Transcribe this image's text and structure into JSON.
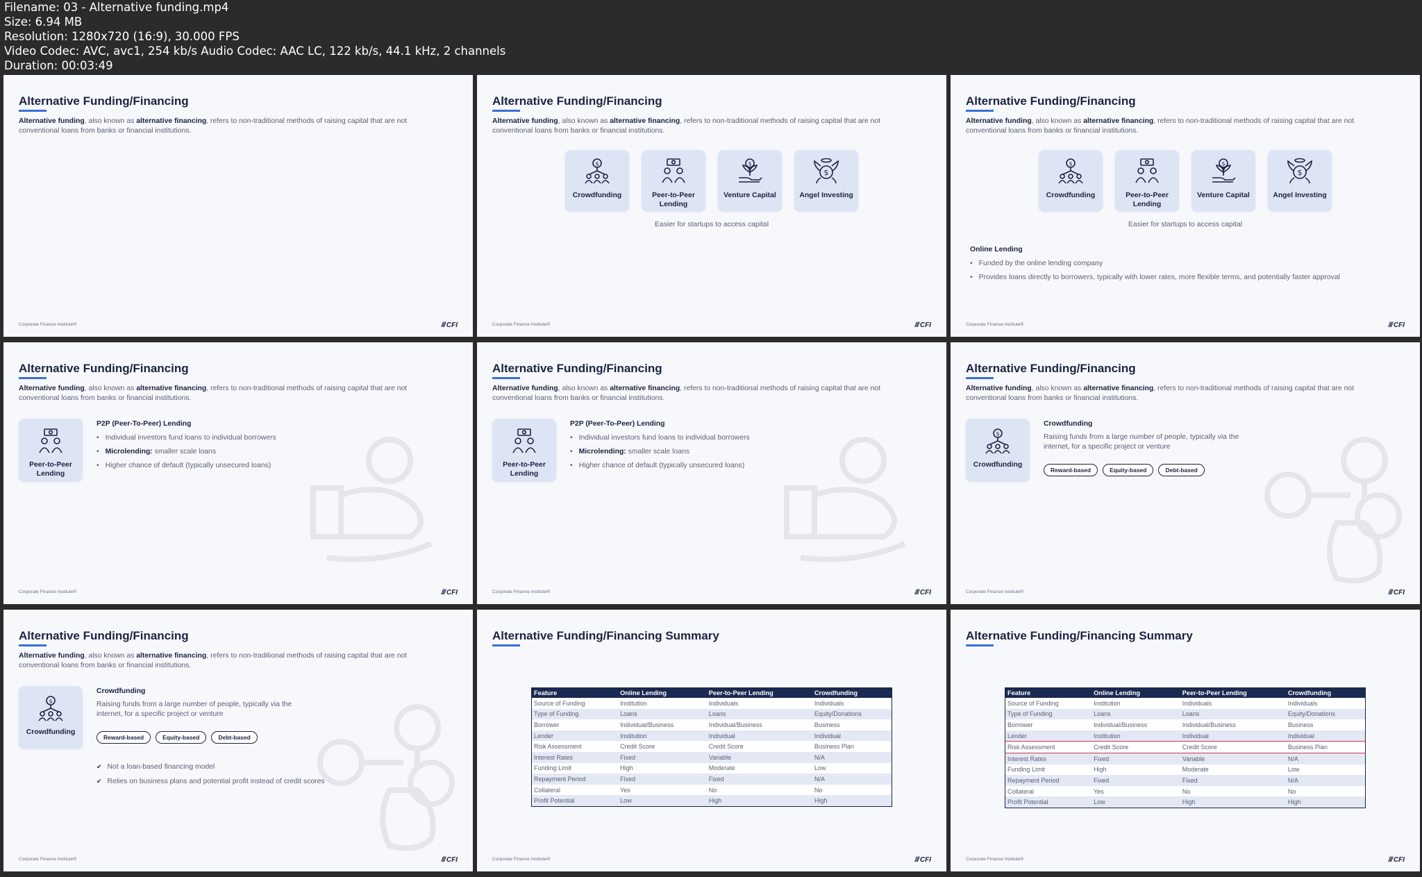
{
  "header": {
    "filename": "Filename: 03 - Alternative funding.mp4",
    "size": "Size: 6.94 MB",
    "resolution": "Resolution: 1280x720 (16:9), 30.000 FPS",
    "codec": "Video Codec: AVC, avc1, 254 kb/s Audio Codec: AAC LC, 122 kb/s, 44.1 kHz, 2 channels",
    "duration": "Duration: 00:03:49"
  },
  "common": {
    "title": "Alternative Funding/Financing",
    "summary_title": "Alternative Funding/Financing Summary",
    "desc_b1": "Alternative funding",
    "desc_t1": ", also known as ",
    "desc_b2": "alternative financing",
    "desc_t2": ", refers to non-traditional methods of raising capital that are not conventional loans from banks or financial institutions.",
    "footer": "Corporate Finance Institute®",
    "logo": "CFI",
    "logo_bars": "///"
  },
  "cards": {
    "crowdfunding": "Crowdfunding",
    "p2p": "Peer-to-Peer Lending",
    "vc": "Venture Capital",
    "angel": "Angel Investing",
    "caption": "Easier for startups to access capital"
  },
  "online_lending": {
    "heading": "Online Lending",
    "bullets": [
      "Funded by the online lending company",
      "Provides loans directly to borrowers, typically with lower rates, more flexible terms, and potentially faster approval"
    ]
  },
  "p2p": {
    "heading": "P2P (Peer-To-Peer) Lending",
    "b1": "Individual investors fund loans to individual borrowers",
    "b2_bold": "Microlending:",
    "b2_text": " smaller scale loans",
    "b3": "Higher chance of default (typically unsecured loans)"
  },
  "crowdfunding": {
    "heading": "Crowdfunding",
    "text": "Raising funds from a large number of people, typically via the internet, for a specific project or venture",
    "pills": [
      "Reward-based",
      "Equity-based",
      "Debt-based"
    ],
    "checks": [
      "Not a loan-based financing model",
      "Relies on business plans and potential profit instead of credit scores"
    ]
  },
  "summary_table": {
    "headers": [
      "Feature",
      "Online Lending",
      "Peer-to-Peer Lending",
      "Crowdfunding"
    ],
    "rows": [
      [
        "Source of Funding",
        "Institution",
        "Individuals",
        "Individuals"
      ],
      [
        "Type of Funding",
        "Loans",
        "Loans",
        "Equity/Donations"
      ],
      [
        "Borrower",
        "Individual/Business",
        "Individual/Business",
        "Business"
      ],
      [
        "Lender",
        "Institution",
        "Individual",
        "Individual"
      ],
      [
        "Risk Assessment",
        "Credit Score",
        "Credit Score",
        "Business Plan"
      ],
      [
        "Interest Rates",
        "Fixed",
        "Variable",
        "N/A"
      ],
      [
        "Funding Limit",
        "High",
        "Moderate",
        "Low"
      ],
      [
        "Repayment Period",
        "Fixed",
        "Fixed",
        "N/A"
      ],
      [
        "Collateral",
        "Yes",
        "No",
        "No"
      ],
      [
        "Profit Potential",
        "Low",
        "High",
        "High"
      ]
    ]
  },
  "colors": {
    "accent": "#3a6fd8",
    "navy": "#1b2340",
    "card_bg": "#dde5f5",
    "highlight": "#d0344b"
  }
}
